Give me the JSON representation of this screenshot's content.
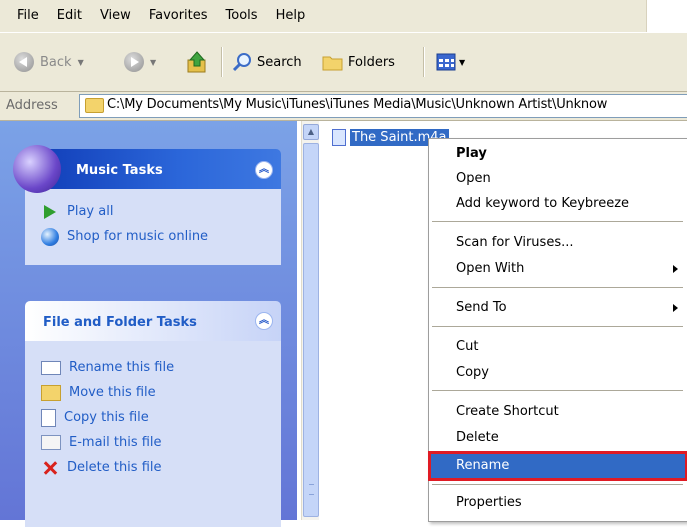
{
  "menubar": {
    "items": [
      "File",
      "Edit",
      "View",
      "Favorites",
      "Tools",
      "Help"
    ]
  },
  "toolbar": {
    "back_label": "Back",
    "search_label": "Search",
    "folders_label": "Folders"
  },
  "address": {
    "label": "Address",
    "path": "C:\\My Documents\\My Music\\iTunes\\iTunes Media\\Music\\Unknown Artist\\Unknow"
  },
  "left_pane": {
    "music_tasks": {
      "title": "Music Tasks",
      "items": [
        "Play all",
        "Shop for music online"
      ]
    },
    "file_tasks": {
      "title": "File and Folder Tasks",
      "items": [
        "Rename this file",
        "Move this file",
        "Copy this file",
        "E-mail this file",
        "Delete this file"
      ]
    }
  },
  "file": {
    "name": "The Saint.m4a"
  },
  "context_menu": {
    "items": [
      "Play",
      "Open",
      "Add keyword to Keybreeze",
      "Scan for Viruses...",
      "Open With",
      "Send To",
      "Cut",
      "Copy",
      "Create Shortcut",
      "Delete",
      "Rename",
      "Properties"
    ],
    "highlighted": "Rename"
  },
  "colors": {
    "selection": "#316ac5",
    "highlight_outline": "#e01b24",
    "pane_gradient_top": "#7ba2e7"
  }
}
